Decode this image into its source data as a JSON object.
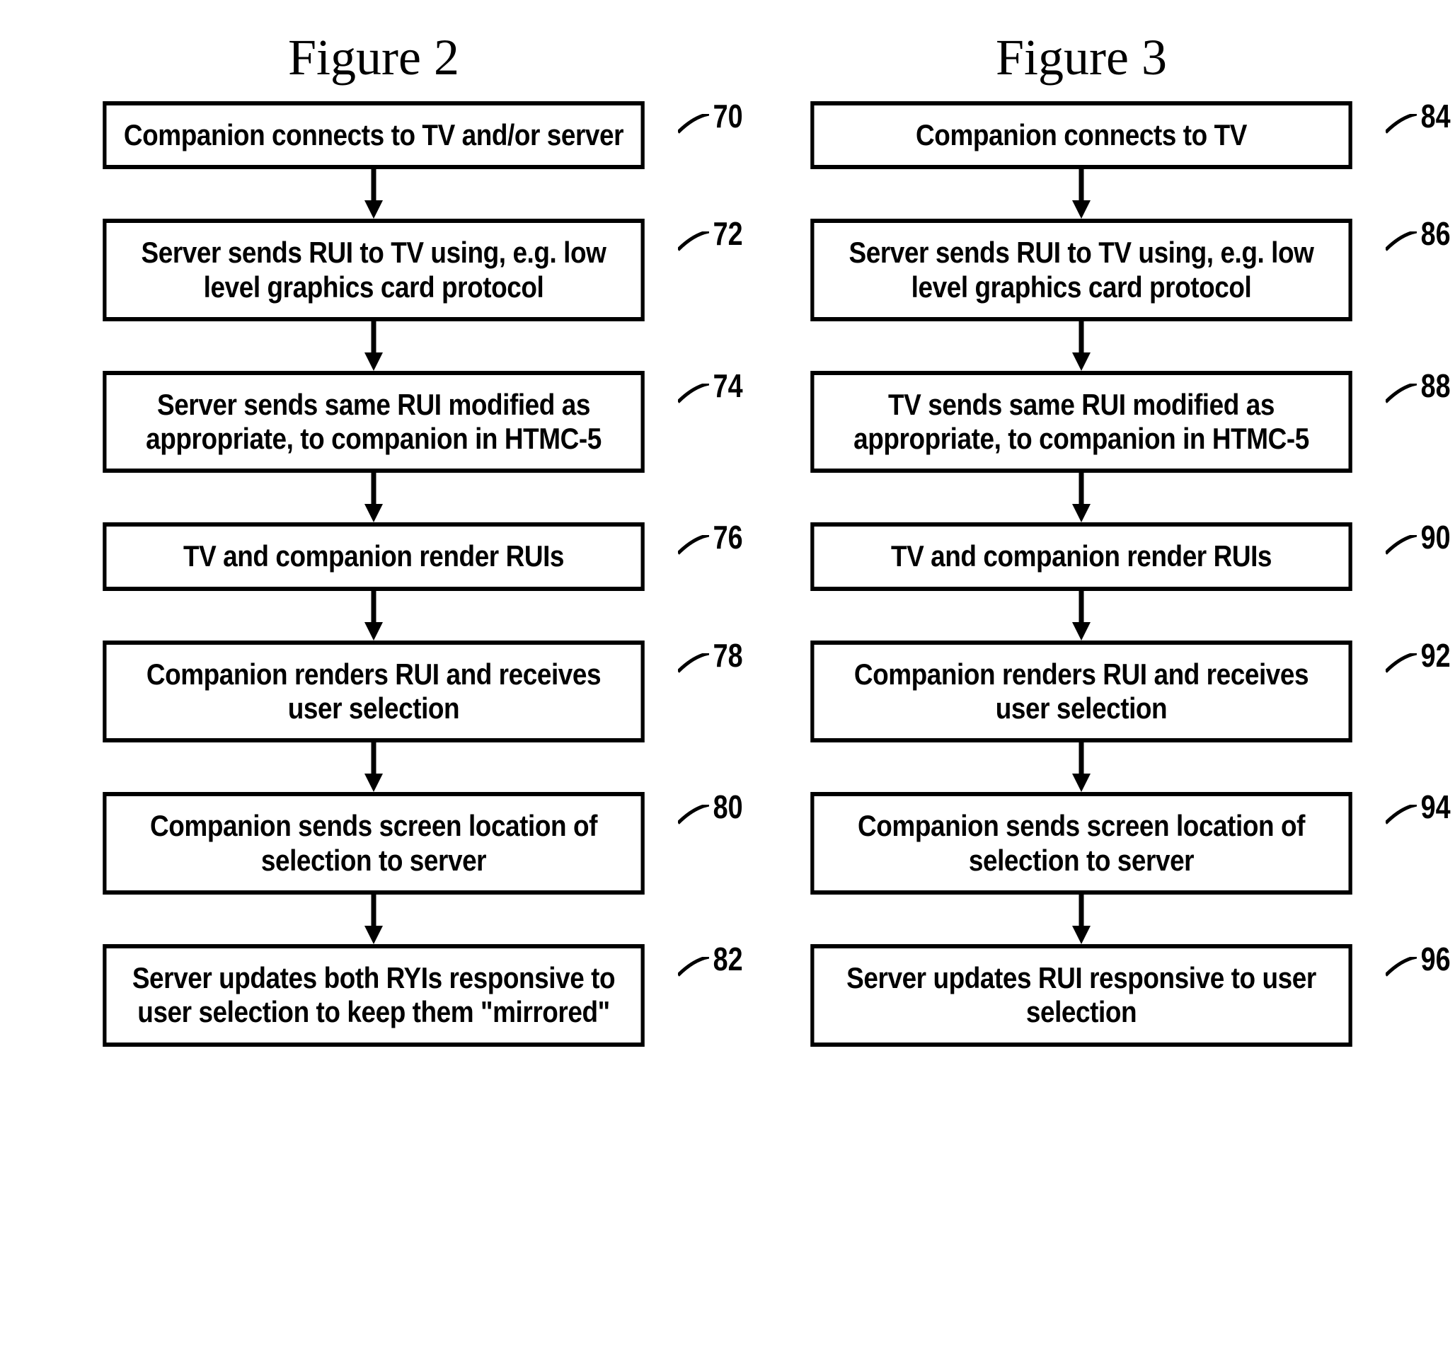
{
  "figures": [
    {
      "title": "Figure 2",
      "steps": [
        {
          "ref": "70",
          "text": "Companion connects to TV and/or server"
        },
        {
          "ref": "72",
          "text": "Server sends RUI to TV using, e.g. low level graphics card protocol"
        },
        {
          "ref": "74",
          "text": "Server sends same RUI modified as appropriate, to companion in HTMC-5"
        },
        {
          "ref": "76",
          "text": "TV and companion render RUIs"
        },
        {
          "ref": "78",
          "text": "Companion renders RUI and receives user selection"
        },
        {
          "ref": "80",
          "text": "Companion sends screen location of selection to server"
        },
        {
          "ref": "82",
          "text": "Server updates both RYIs responsive to user selection to keep them \"mirrored\""
        }
      ]
    },
    {
      "title": "Figure 3",
      "steps": [
        {
          "ref": "84",
          "text": "Companion connects to TV"
        },
        {
          "ref": "86",
          "text": "Server sends RUI to TV using, e.g. low level graphics card protocol"
        },
        {
          "ref": "88",
          "text": "TV sends same RUI modified as appropriate, to companion in HTMC-5"
        },
        {
          "ref": "90",
          "text": "TV and companion render RUIs"
        },
        {
          "ref": "92",
          "text": "Companion renders RUI and receives user selection"
        },
        {
          "ref": "94",
          "text": "Companion sends screen location of selection to server"
        },
        {
          "ref": "96",
          "text": "Server updates RUI responsive to user selection"
        }
      ]
    }
  ]
}
